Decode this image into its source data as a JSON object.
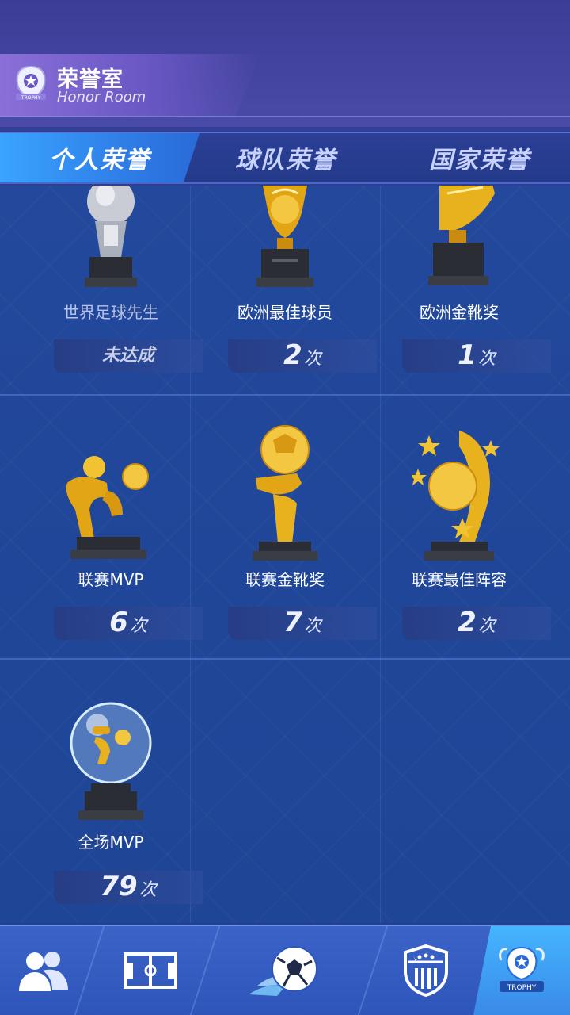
{
  "header": {
    "title": "荣誉室",
    "subtitle": "Honor Room",
    "emblem_text": "TROPHY"
  },
  "tabs": [
    {
      "label": "个人荣誉",
      "active": true
    },
    {
      "label": "球队荣誉",
      "active": false
    },
    {
      "label": "国家荣誉",
      "active": false
    }
  ],
  "awards": [
    {
      "name": "世界足球先生",
      "status": "未达成",
      "count": null,
      "unit": "",
      "achieved": false,
      "icon": "silver-trophy-icon"
    },
    {
      "name": "欧洲最佳球员",
      "status": "",
      "count": "2",
      "unit": "次",
      "achieved": true,
      "icon": "golden-ball-trophy-icon"
    },
    {
      "name": "欧洲金靴奖",
      "status": "",
      "count": "1",
      "unit": "次",
      "achieved": true,
      "icon": "golden-boot-icon"
    },
    {
      "name": "联赛MVP",
      "status": "",
      "count": "6",
      "unit": "次",
      "achieved": true,
      "icon": "mvp-trophy-icon"
    },
    {
      "name": "联赛金靴奖",
      "status": "",
      "count": "7",
      "unit": "次",
      "achieved": true,
      "icon": "league-boot-trophy-icon"
    },
    {
      "name": "联赛最佳阵容",
      "status": "",
      "count": "2",
      "unit": "次",
      "achieved": true,
      "icon": "best-team-trophy-icon"
    },
    {
      "name": "全场MVP",
      "status": "",
      "count": "79",
      "unit": "次",
      "achieved": true,
      "icon": "match-mvp-trophy-icon"
    }
  ],
  "nav": [
    {
      "icon": "players-icon"
    },
    {
      "icon": "pitch-icon"
    },
    {
      "icon": "football-icon"
    },
    {
      "icon": "club-badge-icon"
    },
    {
      "icon": "trophy-emblem-icon",
      "label": "TROPHY",
      "active": true
    }
  ],
  "colors": {
    "accent": "#3aa4ff",
    "gold": "#e8b21e",
    "panel": "#23489c"
  }
}
